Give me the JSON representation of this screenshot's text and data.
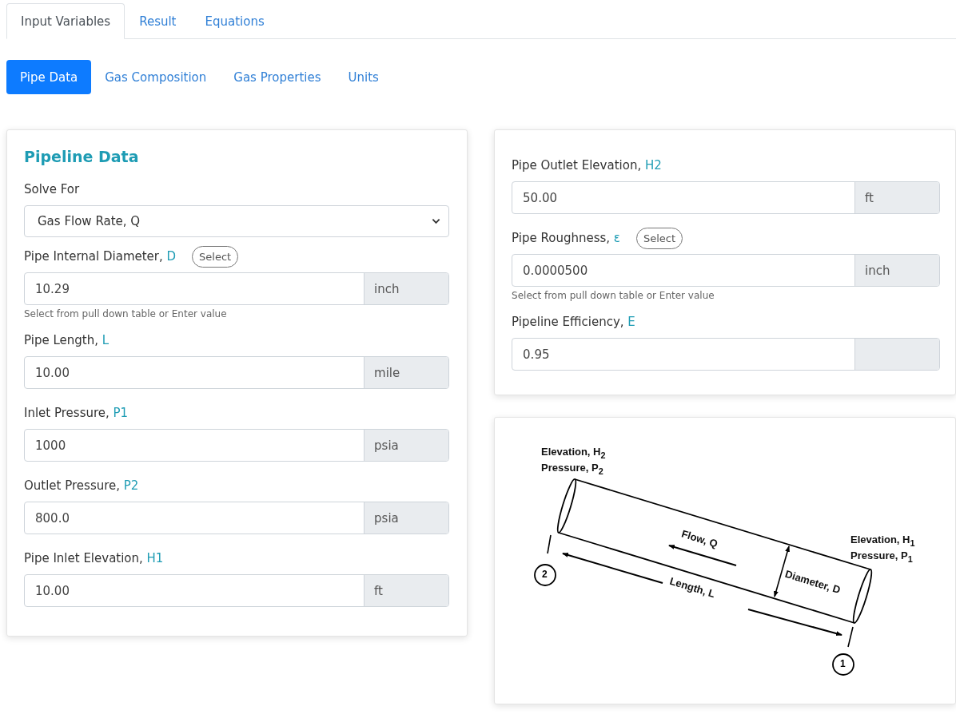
{
  "tabs": [
    {
      "label": "Input Variables",
      "selected": true
    },
    {
      "label": "Result",
      "selected": false
    },
    {
      "label": "Equations",
      "selected": false
    }
  ],
  "subtabs": [
    {
      "label": "Pipe Data",
      "selected": true
    },
    {
      "label": "Gas Composition",
      "selected": false
    },
    {
      "label": "Gas Properties",
      "selected": false
    },
    {
      "label": "Units",
      "selected": false
    }
  ],
  "left_card": {
    "title": "Pipeline Data",
    "solve_for": {
      "label": "Solve For",
      "value": "Gas Flow Rate, Q"
    },
    "fields": [
      {
        "label": "Pipe Internal Diameter,",
        "symbol": "D",
        "select_button": "Select",
        "value": "10.29",
        "unit": "inch",
        "hint": "Select from pull down table or Enter value"
      },
      {
        "label": "Pipe Length,",
        "symbol": "L",
        "value": "10.00",
        "unit": "mile"
      },
      {
        "label": "Inlet Pressure,",
        "symbol": "P1",
        "value": "1000",
        "unit": "psia"
      },
      {
        "label": "Outlet Pressure,",
        "symbol": "P2",
        "value": "800.0",
        "unit": "psia"
      },
      {
        "label": "Pipe Inlet Elevation,",
        "symbol": "H1",
        "value": "10.00",
        "unit": "ft"
      }
    ]
  },
  "right_card": {
    "fields": [
      {
        "label": "Pipe Outlet Elevation,",
        "symbol": "H2",
        "value": "50.00",
        "unit": "ft"
      },
      {
        "label": "Pipe Roughness,",
        "symbol": "ε",
        "select_button": "Select",
        "value": "0.0000500",
        "unit": "inch",
        "hint": "Select from pull down table or Enter value"
      },
      {
        "label": "Pipeline Efficiency,",
        "symbol": "E",
        "value": "0.95"
      }
    ]
  },
  "diagram": {
    "outlet_label": [
      "Elevation, H$_{2}$",
      "Pressure, P$_{2}$"
    ],
    "inlet_label": [
      "Elevation, H$_{1}$",
      "Pressure, P$_{1}$"
    ],
    "flow": "Flow, Q",
    "length": "Length, L",
    "diameter": "Diameter, D",
    "outlet_node": "2",
    "inlet_node": "1"
  }
}
